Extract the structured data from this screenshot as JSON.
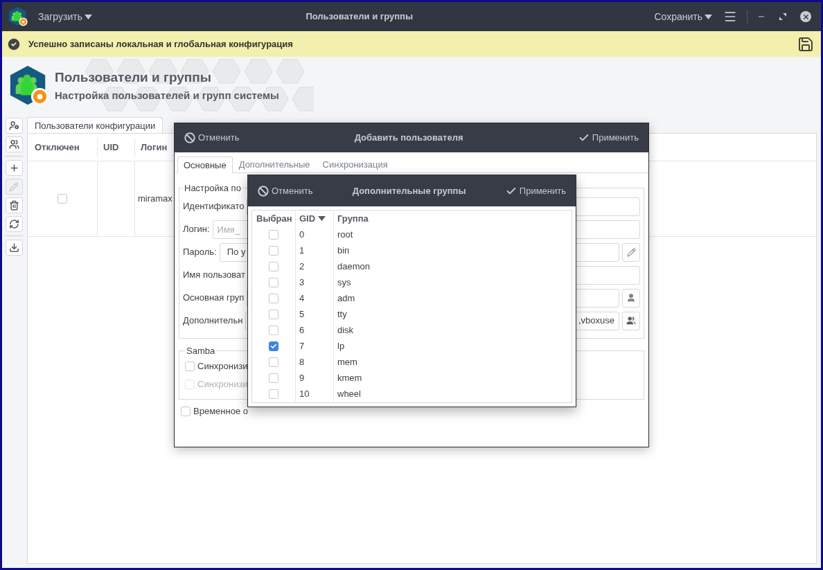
{
  "titlebar": {
    "load_menu": "Загрузить",
    "title": "Пользователи и группы",
    "save_menu": "Сохранить"
  },
  "notification": {
    "message": "Успешно записаны локальная и глобальная конфигурация"
  },
  "header": {
    "title": "Пользователи и группы",
    "subtitle": "Настройка пользователей и групп системы"
  },
  "toolbar": [
    {
      "kind": "user-settings",
      "disabled": false
    },
    {
      "kind": "group",
      "disabled": false
    },
    {
      "kind": "add",
      "disabled": false
    },
    {
      "kind": "edit",
      "disabled": true
    },
    {
      "kind": "delete",
      "disabled": false
    },
    {
      "kind": "refresh",
      "disabled": false
    },
    {
      "kind": "download",
      "disabled": false
    }
  ],
  "main_tabs": [
    {
      "label": "Пользователи конфигурации",
      "selected": true
    }
  ],
  "users_table": {
    "columns": [
      "Отключен",
      "UID",
      "Логин"
    ],
    "rows": [
      {
        "checked": false,
        "login": "miramax"
      }
    ]
  },
  "add_user_dialog": {
    "cancel": "Отменить",
    "title": "Добавить пользователя",
    "apply": "Применить",
    "tabs": [
      {
        "label": "Основные",
        "selected": true
      },
      {
        "label": "Дополнительные",
        "selected": false
      },
      {
        "label": "Синхронизация",
        "selected": false
      }
    ],
    "settings_legend": "Настройка по",
    "fields": [
      {
        "kind": "text",
        "label": "Идентификато"
      },
      {
        "kind": "text",
        "label": "Логин:",
        "placeholder": "Имя_"
      },
      {
        "kind": "select-edit",
        "label": "Пароль:",
        "value": "По у"
      },
      {
        "kind": "text",
        "label": "Имя пользоват"
      },
      {
        "kind": "pick-user",
        "label": "Основная груп"
      },
      {
        "kind": "pick-group",
        "label": "Дополнительн",
        "value": ",vboxuse"
      }
    ],
    "samba_legend": "Samba",
    "samba_options": [
      {
        "label": "Синхронизи",
        "checked": false,
        "disabled": false
      },
      {
        "label": "Синхронизи",
        "checked": false,
        "disabled": true
      }
    ],
    "temporary": {
      "label": "Временное о",
      "checked": false
    }
  },
  "groups_dialog": {
    "cancel": "Отменить",
    "title": "Дополнительные группы",
    "apply": "Применить",
    "columns": [
      "Выбран",
      "GID",
      "Группа"
    ],
    "rows": [
      {
        "checked": false,
        "gid": "0",
        "name": "root"
      },
      {
        "checked": false,
        "gid": "1",
        "name": "bin"
      },
      {
        "checked": false,
        "gid": "2",
        "name": "daemon"
      },
      {
        "checked": false,
        "gid": "3",
        "name": "sys"
      },
      {
        "checked": false,
        "gid": "4",
        "name": "adm"
      },
      {
        "checked": false,
        "gid": "5",
        "name": "tty"
      },
      {
        "checked": false,
        "gid": "6",
        "name": "disk"
      },
      {
        "checked": true,
        "gid": "7",
        "name": "lp"
      },
      {
        "checked": false,
        "gid": "8",
        "name": "mem"
      },
      {
        "checked": false,
        "gid": "9",
        "name": "kmem"
      },
      {
        "checked": false,
        "gid": "10",
        "name": "wheel"
      }
    ]
  }
}
